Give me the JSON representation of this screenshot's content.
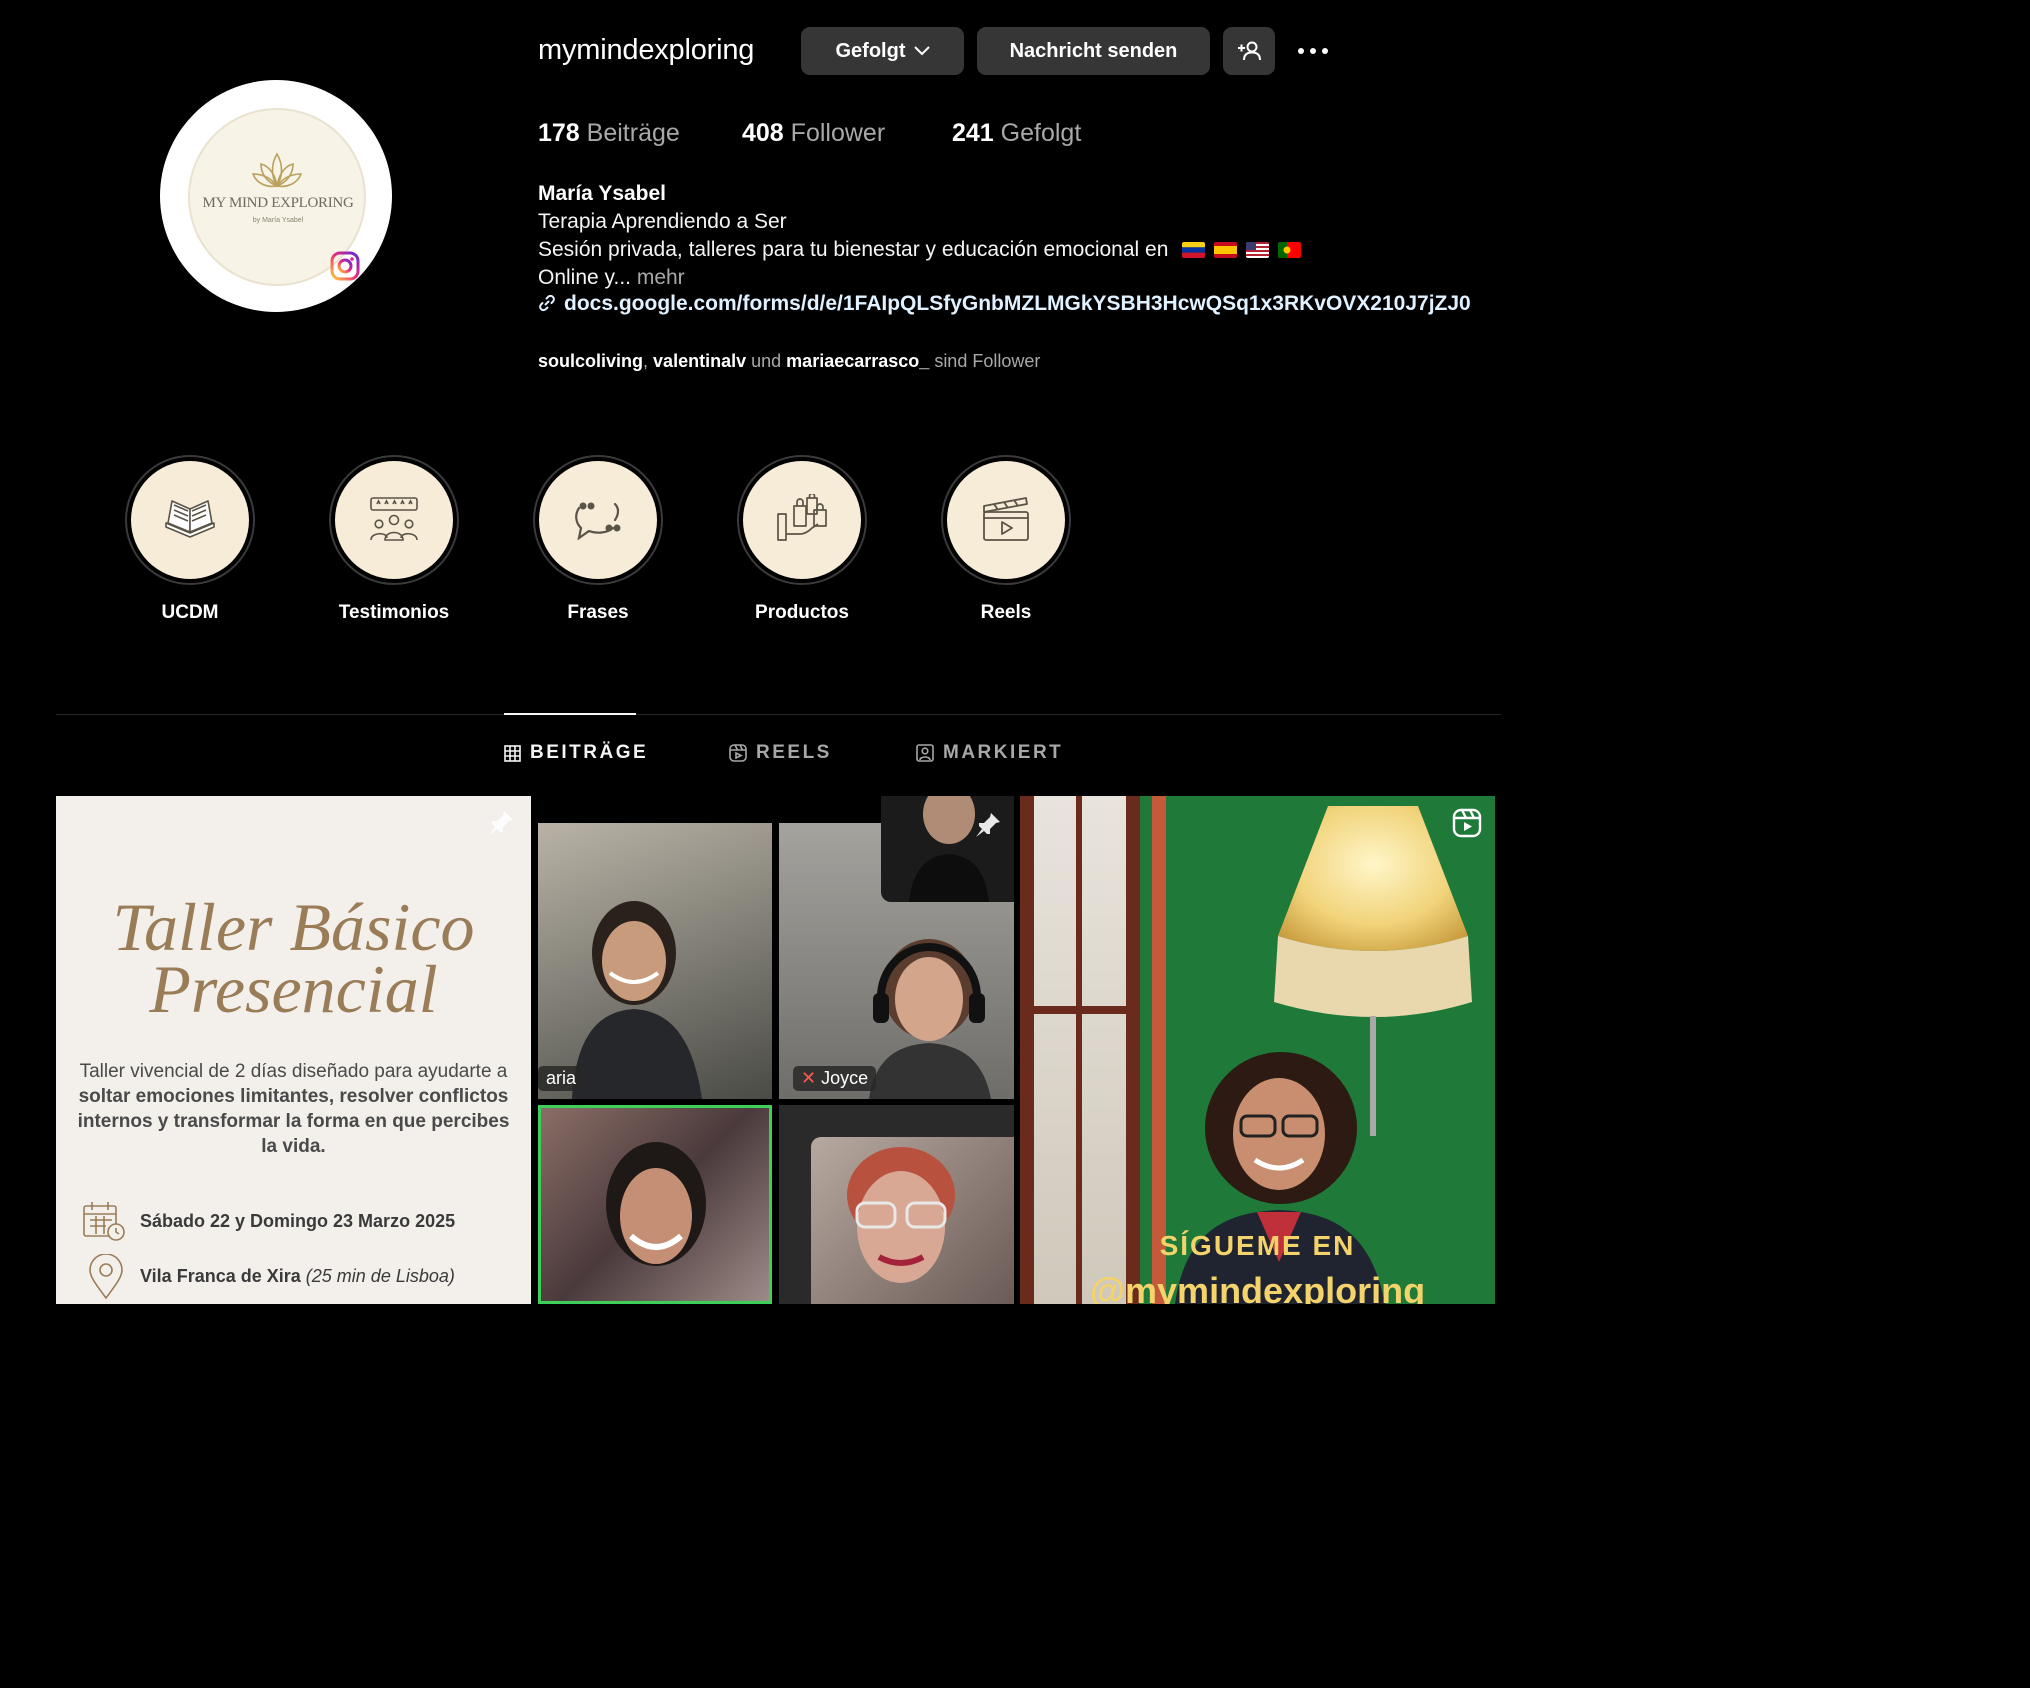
{
  "profile": {
    "username": "mymindexploring",
    "follow_button": "Gefolgt",
    "message_button": "Nachricht senden",
    "avatar_logo_text": "MY MIND EXPLORING",
    "avatar_logo_sub": "by María Ysabel"
  },
  "stats": {
    "posts_count": "178",
    "posts_label": "Beiträge",
    "followers_count": "408",
    "followers_label": "Follower",
    "following_count": "241",
    "following_label": "Gefolgt"
  },
  "bio": {
    "name": "María Ysabel",
    "line1": "Terapia Aprendiendo a Ser",
    "line2": "Sesión privada, talleres para tu bienestar y educación emocional en",
    "line3": "Online y...",
    "more": "mehr",
    "link": "docs.google.com/forms/d/e/1FAIpQLSfyGnbMZLMGkYSBH3HcwQSq1x3RKvOVX210J7jZJ0"
  },
  "followed_by": {
    "user1": "soulcoliving",
    "sep": ",",
    "user2": "valentinalv",
    "und": "und",
    "user3": "mariaecarrasco_",
    "suffix": "sind Follower"
  },
  "highlights": [
    {
      "label": "UCDM"
    },
    {
      "label": "Testimonios"
    },
    {
      "label": "Frases"
    },
    {
      "label": "Productos"
    },
    {
      "label": "Reels"
    }
  ],
  "tabs": [
    {
      "label": "BEITRÄGE"
    },
    {
      "label": "REELS"
    },
    {
      "label": "MARKIERT"
    }
  ],
  "posts": {
    "post1": {
      "title_line1": "Taller Básico",
      "title_line2": "Presencial",
      "desc_plain": "Taller vivencial de 2 días diseñado para ayudarte a",
      "desc_bold": "soltar emociones limitantes, resolver conflictos internos y transformar la forma en que percibes la vida.",
      "date": "Sábado 22 y Domingo 23 Marzo 2025",
      "location": "Vila Franca de Xira",
      "location_note": "(25 min de Lisboa)"
    },
    "post2": {
      "name_tag_1": "aria",
      "name_tag_2": "Joyce"
    },
    "post3": {
      "line1": "SÍGUEME EN",
      "line2": "@mymindexploring"
    }
  },
  "colors": {
    "background": "#000000",
    "button": "#363636",
    "link": "#e0f1ff",
    "muted": "#a8a8a8",
    "taller_gold": "#9a7c57"
  }
}
